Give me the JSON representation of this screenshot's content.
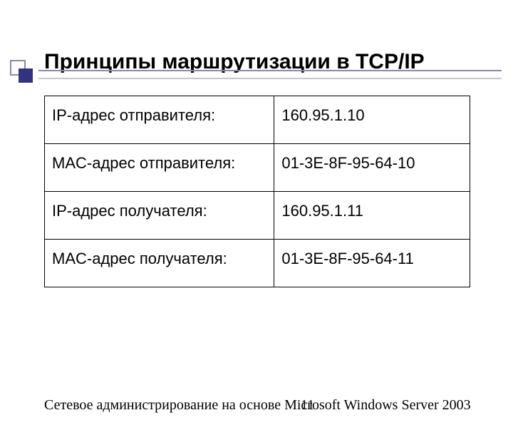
{
  "title": "Принципы маршрутизации в TCP/IP",
  "table": {
    "rows": [
      {
        "label": "IP-адрес отправителя:",
        "value": "160.95.1.10"
      },
      {
        "label": "MAC-адрес отправителя:",
        "value": "01-3E-8F-95-64-10"
      },
      {
        "label": "IP-адрес получателя:",
        "value": "160.95.1.11"
      },
      {
        "label": "MAC-адрес получателя:",
        "value": "01-3E-8F-95-64-11"
      }
    ]
  },
  "footer": {
    "text": "Сетевое администрирование на основе Microsoft Windows Server 2003",
    "page": "11"
  }
}
